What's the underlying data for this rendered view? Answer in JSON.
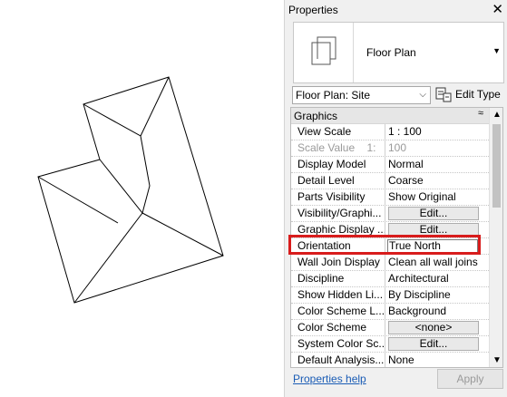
{
  "panel": {
    "title": "Properties",
    "close_glyph": "✕",
    "type_name": "Floor Plan",
    "type_dropdown_glyph": "▼",
    "instance_selector": "Floor Plan: Site",
    "selector_glyph": "⌵",
    "edit_type_label": "Edit Type"
  },
  "group": {
    "label": "Graphics",
    "collapse_glyph": "≈"
  },
  "scrollbar": {
    "up": "▲",
    "down": "▼"
  },
  "rows": [
    {
      "name": "View Scale",
      "value": "1 : 100"
    },
    {
      "name": "Scale Value    1:",
      "value": "100"
    },
    {
      "name": "Display Model",
      "value": "Normal"
    },
    {
      "name": "Detail Level",
      "value": "Coarse"
    },
    {
      "name": "Parts Visibility",
      "value": "Show Original"
    },
    {
      "name": "Visibility/Graphi...",
      "value": "Edit..."
    },
    {
      "name": "Graphic Display ...",
      "value": "Edit..."
    },
    {
      "name": "Orientation",
      "value": "True North"
    },
    {
      "name": "Wall Join Display",
      "value": "Clean all wall joins"
    },
    {
      "name": "Discipline",
      "value": "Architectural"
    },
    {
      "name": "Show Hidden Li...",
      "value": "By Discipline"
    },
    {
      "name": "Color Scheme L...",
      "value": "Background"
    },
    {
      "name": "Color Scheme",
      "value": "<none>"
    },
    {
      "name": "System Color Sc...",
      "value": "Edit..."
    },
    {
      "name": "Default Analysis...",
      "value": "None"
    }
  ],
  "footer": {
    "help_link": "Properties help",
    "apply_label": "Apply"
  },
  "colors": {
    "highlight": "#d81c1c",
    "link": "#1a5cb5"
  }
}
